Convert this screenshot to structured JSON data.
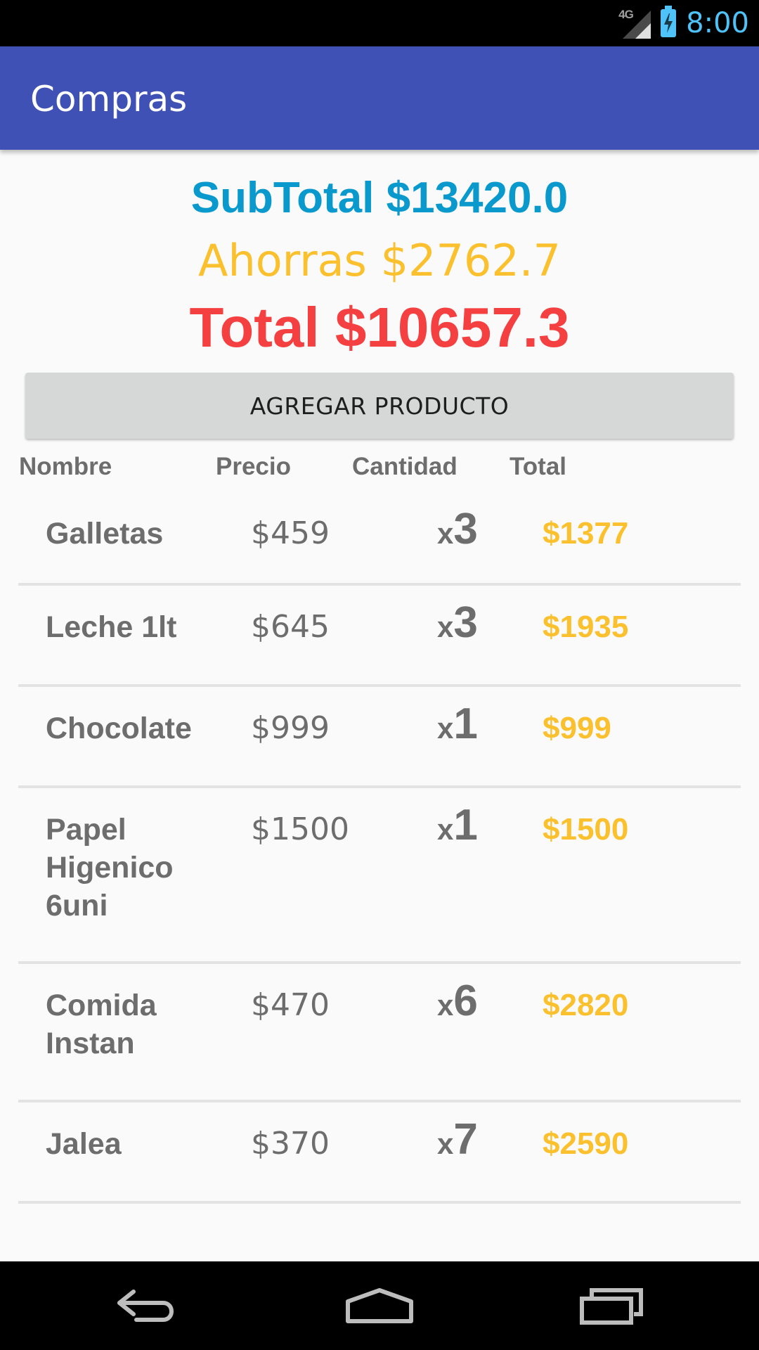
{
  "status_bar": {
    "network": "4G",
    "time": "8:00"
  },
  "app_bar": {
    "title": "Compras"
  },
  "summary": {
    "subtotal": "SubTotal $13420.0",
    "savings": "Ahorras $2762.7",
    "total": "Total $10657.3"
  },
  "add_button": {
    "label": "AGREGAR PRODUCTO"
  },
  "table": {
    "headers": {
      "name": "Nombre",
      "price": "Precio",
      "quantity": "Cantidad",
      "total": "Total"
    },
    "rows": [
      {
        "name": "Galletas",
        "price": "$459",
        "qty_prefix": "x",
        "qty": "3",
        "total": "$1377"
      },
      {
        "name": "Leche 1lt",
        "price": "$645",
        "qty_prefix": "x",
        "qty": "3",
        "total": "$1935"
      },
      {
        "name": "Chocolate",
        "price": "$999",
        "qty_prefix": "x",
        "qty": "1",
        "total": "$999"
      },
      {
        "name": "Papel Higenico 6uni",
        "price": "$1500",
        "qty_prefix": "x",
        "qty": "1",
        "total": "$1500"
      },
      {
        "name": "Comida Instan",
        "price": "$470",
        "qty_prefix": "x",
        "qty": "6",
        "total": "$2820"
      },
      {
        "name": "Jalea",
        "price": "$370",
        "qty_prefix": "x",
        "qty": "7",
        "total": "$2590"
      }
    ]
  },
  "colors": {
    "primary": "#3f51b5",
    "subtotal": "#0a99cc",
    "savings": "#fbc02d",
    "total": "#f44040",
    "text_gray": "#6d6d6d"
  },
  "icons": {
    "signal": "signal-icon",
    "battery": "battery-charging-icon",
    "back": "back-icon",
    "home": "home-icon",
    "recents": "recents-icon"
  }
}
